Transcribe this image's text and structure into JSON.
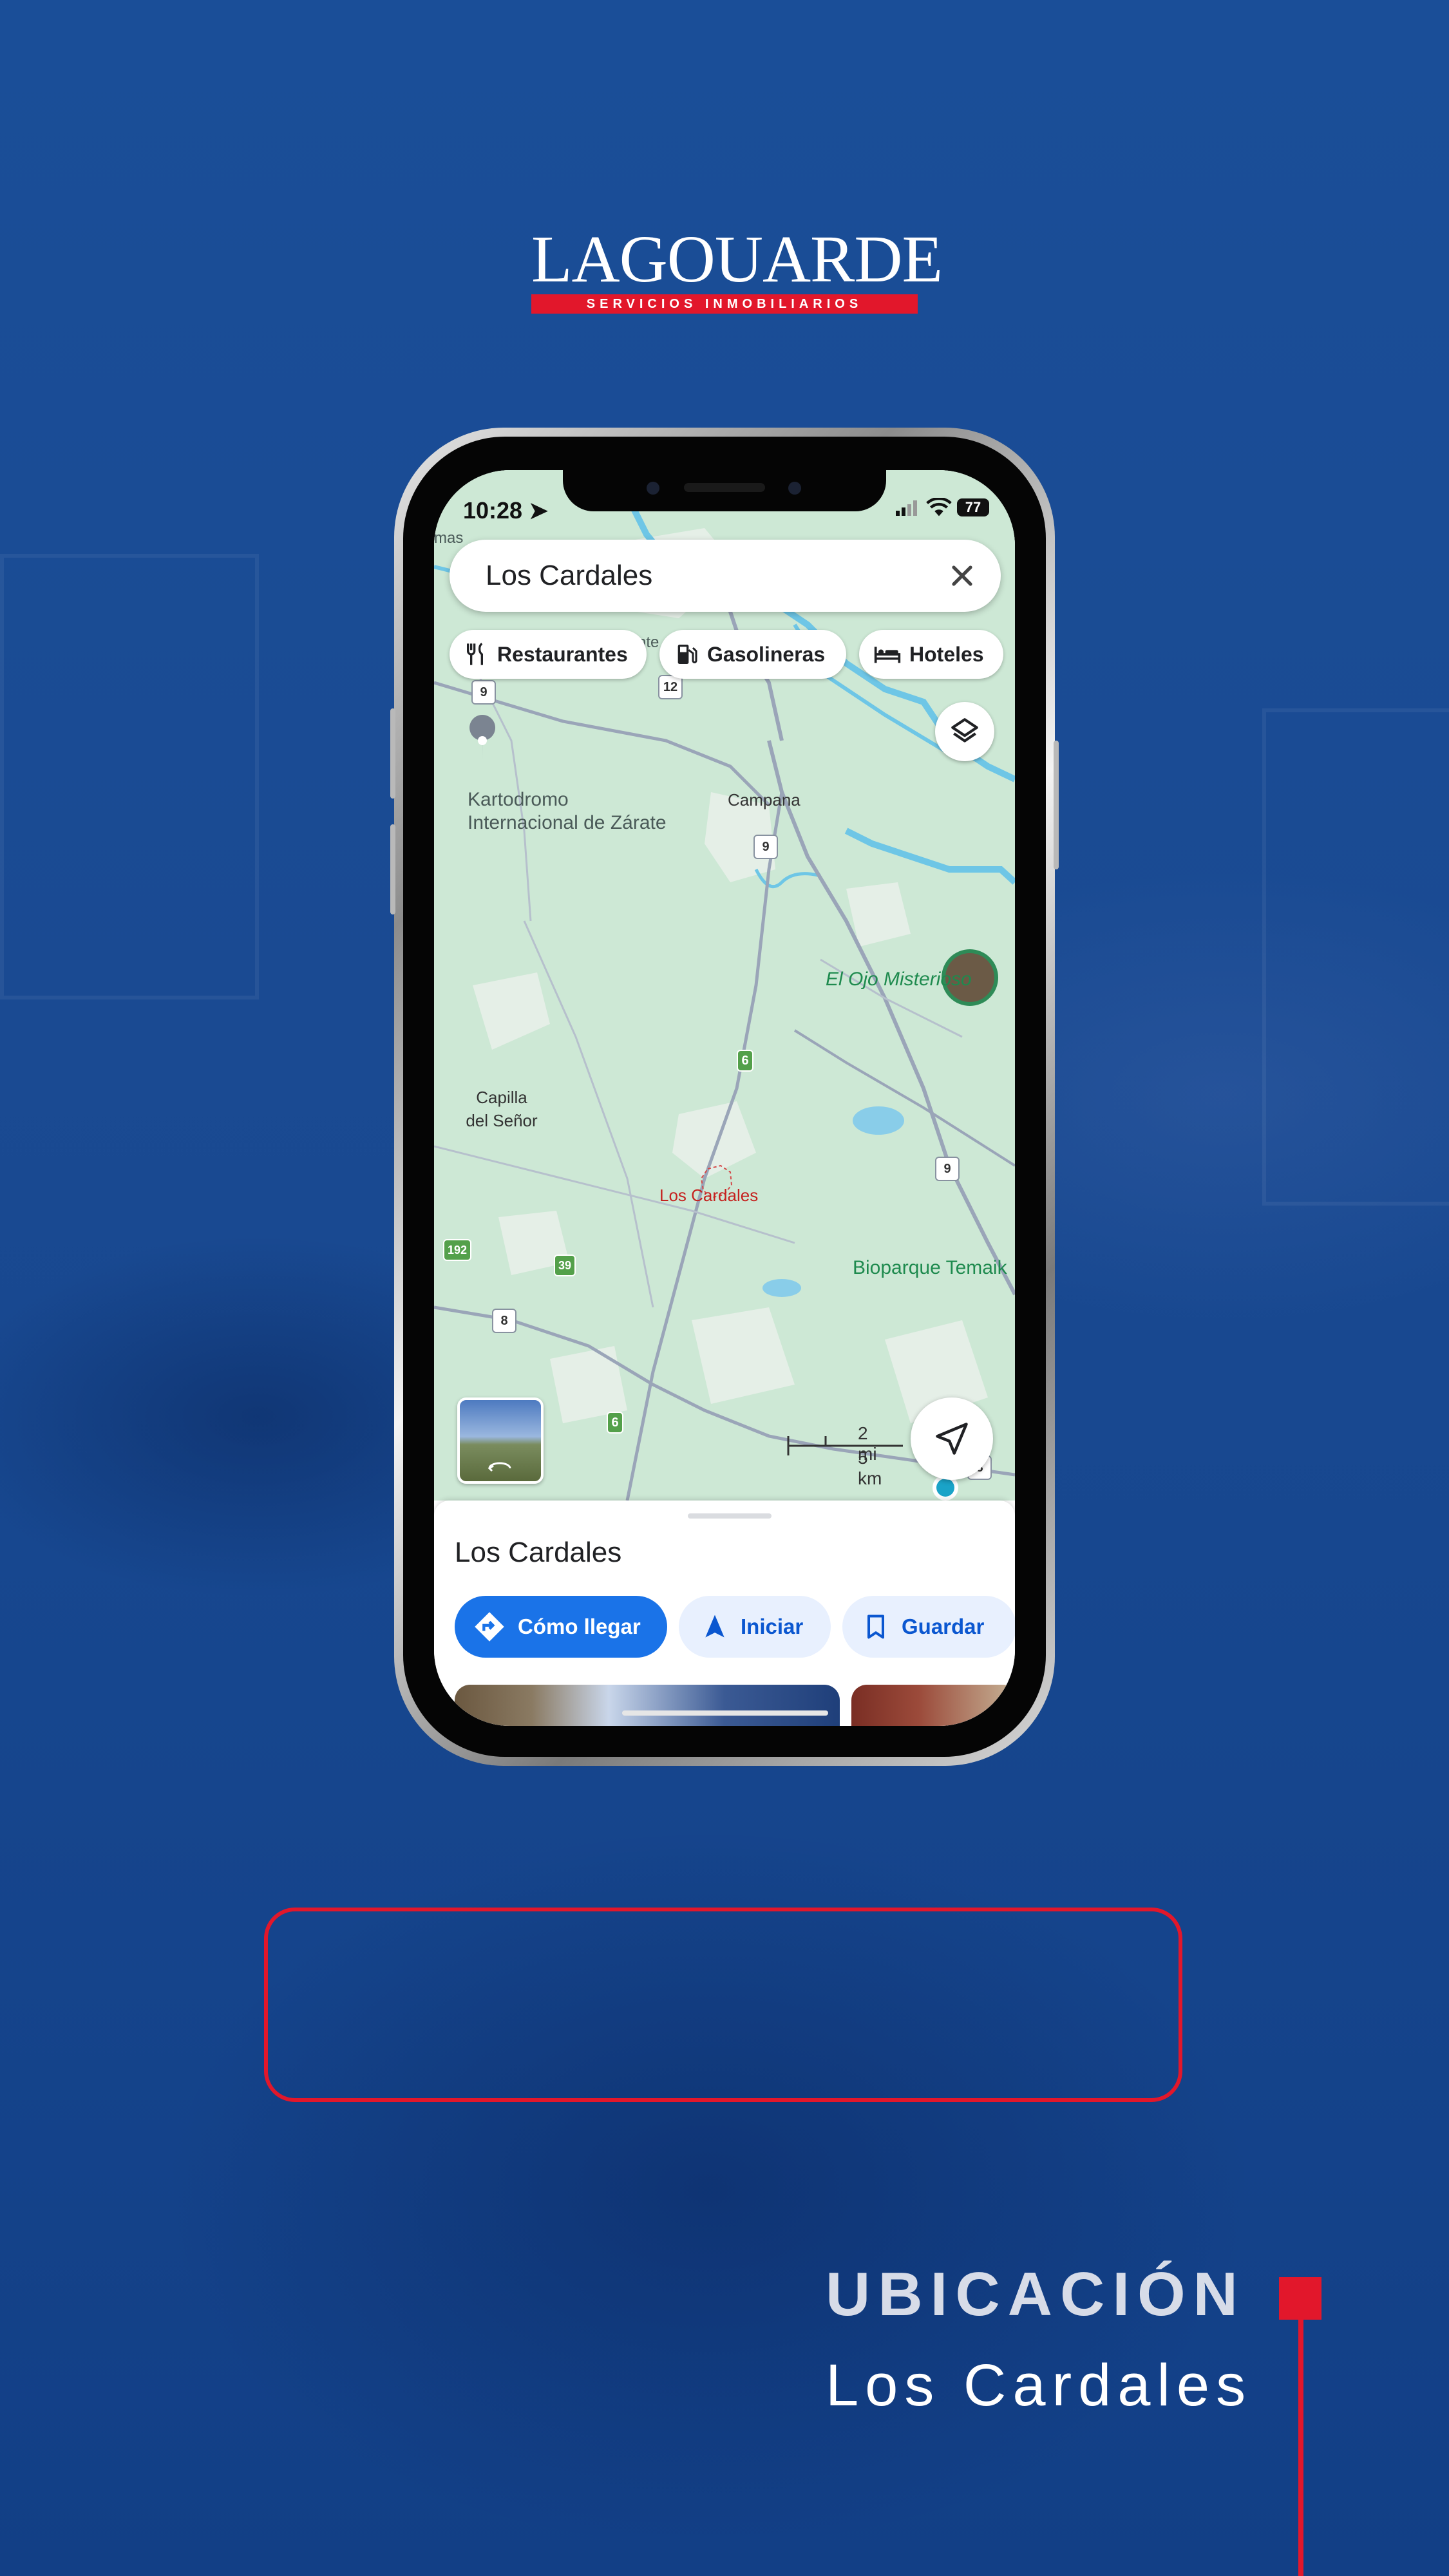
{
  "brand": {
    "name": "LAGOUARDE",
    "tagline": "SERVICIOS INMOBILIARIOS",
    "accent": "#e2172b",
    "background": "#17488f"
  },
  "status_bar": {
    "time": "10:28",
    "battery": "77"
  },
  "search": {
    "value": "Los Cardales"
  },
  "chips": [
    {
      "label": "Restaurantes",
      "icon": "fork-knife-icon"
    },
    {
      "label": "Gasolineras",
      "icon": "gas-pump-icon"
    },
    {
      "label": "Hoteles",
      "icon": "bed-icon"
    }
  ],
  "map": {
    "labels": {
      "edge": "mas",
      "kartodromo": "Kartodromo\nInternacional de Zárate",
      "campana": "Campana",
      "capilla": "Capilla\ndel Señor",
      "cardales": "Los Cardales",
      "ojo": "El Ojo Misterioso",
      "bioparque": "Bioparque Temaik",
      "partial": "nte"
    },
    "routes": {
      "r9a": "9",
      "r12": "12",
      "r9b": "9",
      "r6a": "6",
      "r9c": "9",
      "r192": "192",
      "r39": "39",
      "r8": "8",
      "r6b": "6",
      "r8b": "8"
    },
    "scale": {
      "mi": "2 mi",
      "km": "5 km"
    }
  },
  "sheet": {
    "title": "Los Cardales",
    "directions": "Cómo llegar",
    "start": "Iniciar",
    "save": "Guardar"
  },
  "footer": {
    "heading": "UBICACIÓN",
    "location": "Los Cardales"
  }
}
